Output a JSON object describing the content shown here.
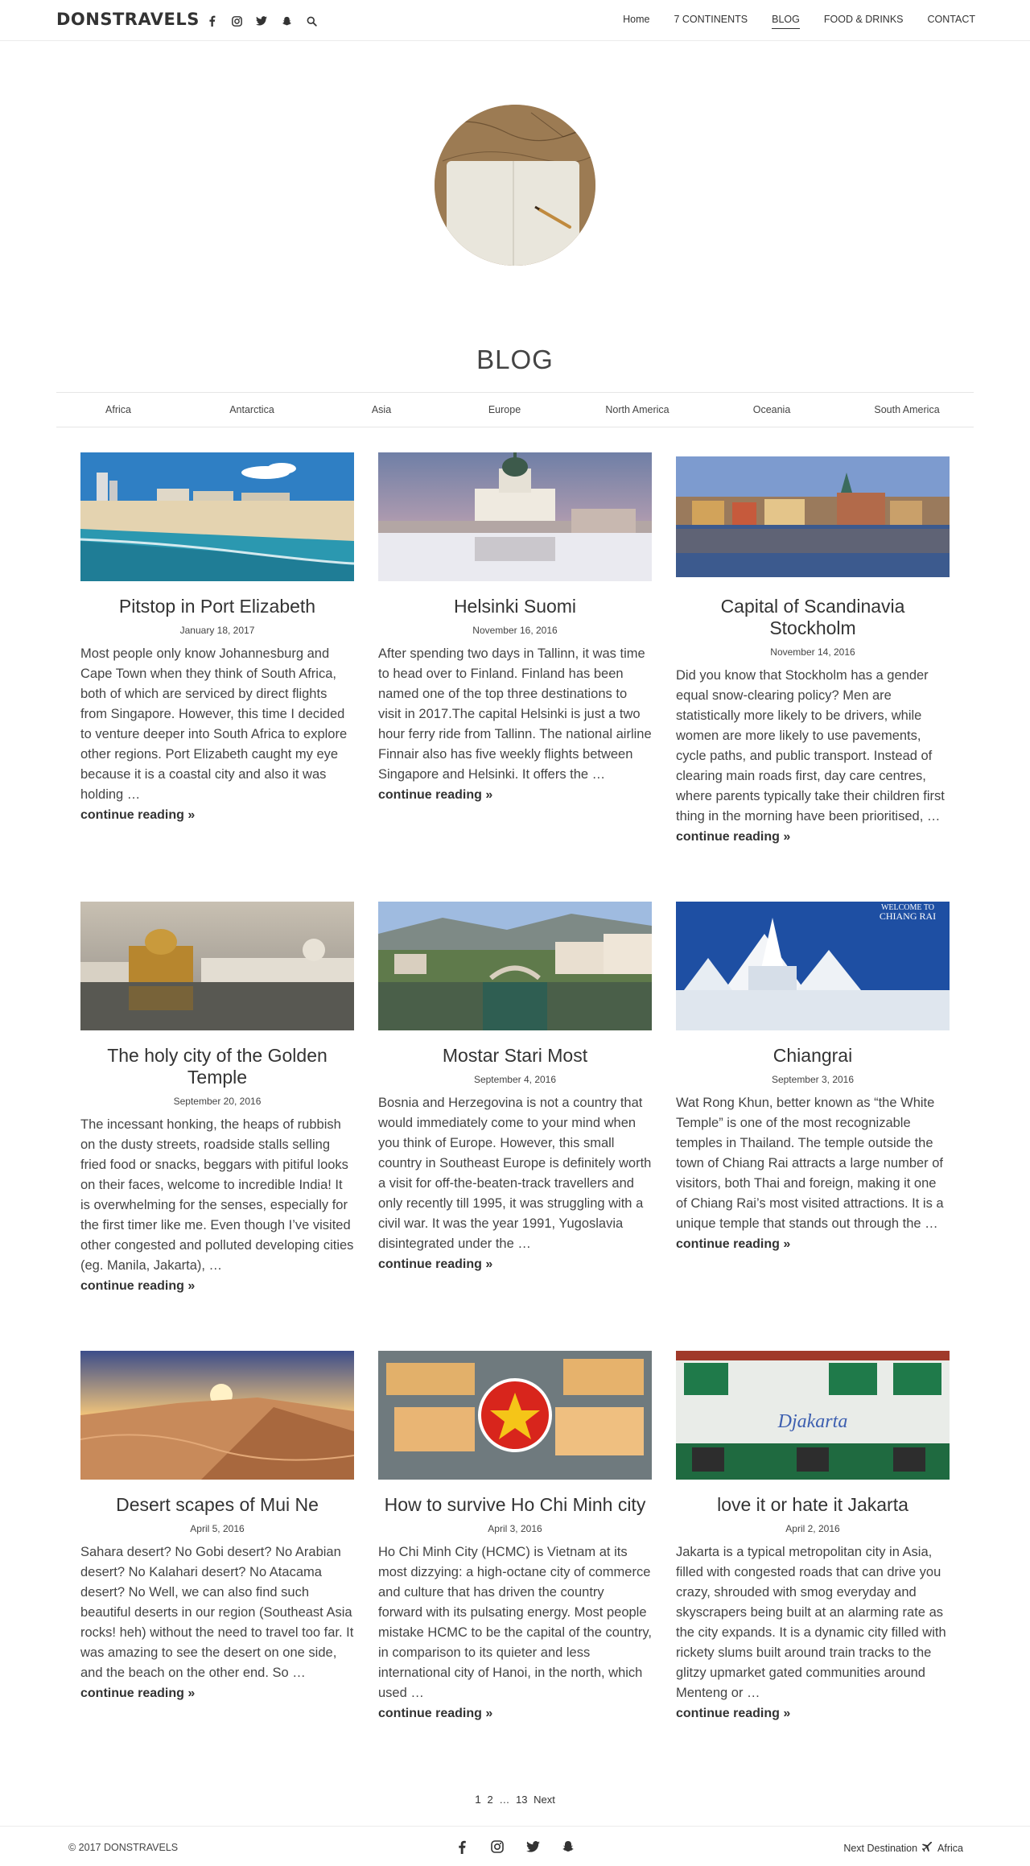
{
  "header": {
    "logo": "DONSTRAVELS",
    "nav": [
      "Home",
      "7 CONTINENTS",
      "BLOG",
      "FOOD & DRINKS",
      "CONTACT"
    ]
  },
  "page_title": "BLOG",
  "categories": [
    "Africa",
    "Antarctica",
    "Asia",
    "Europe",
    "North America",
    "Oceania",
    "South America"
  ],
  "posts": [
    {
      "title": "Pitstop in Port Elizabeth",
      "date": "January 18, 2017",
      "excerpt": "Most people only know Johannesburg and Cape Town when they think of South Africa, both of which are serviced by direct flights from Singapore. However, this time I decided to venture deeper into South Africa to explore other regions. Port Elizabeth caught my eye because it is a coastal city and also it was holding …",
      "more": "continue reading »"
    },
    {
      "title": "Helsinki Suomi",
      "date": "November 16, 2016",
      "excerpt": "After spending two days in Tallinn, it was time to head over to Finland. Finland has been named one of the top three destinations to visit in 2017.The capital Helsinki is just a two hour ferry ride from Tallinn. The national airline Finnair also has five weekly flights between Singapore and Helsinki. It offers the …",
      "more": "continue reading »"
    },
    {
      "title": "Capital of Scandinavia Stockholm",
      "date": "November 14, 2016",
      "excerpt": "Did you know that Stockholm has a gender equal snow-clearing policy? Men are statistically more likely to be drivers, while women are more likely to use pavements, cycle paths, and public transport. Instead of clearing main roads first, day care centres, where parents typically take their children first thing in the morning have been prioritised, …",
      "more": "continue reading »"
    },
    {
      "title": "The holy city of the Golden Temple",
      "date": "September 20, 2016",
      "excerpt": "The incessant honking, the heaps of rubbish on the dusty streets, roadside stalls selling fried food or snacks, beggars with pitiful looks on their faces, welcome to incredible India! It is overwhelming for the senses, especially for the first timer like me. Even though I’ve visited other congested and polluted developing cities (eg. Manila, Jakarta), …",
      "more": "continue reading »"
    },
    {
      "title": "Mostar Stari Most",
      "date": "September 4, 2016",
      "excerpt": "Bosnia and Herzegovina is not a country that would immediately come to your mind when you think of Europe. However, this small country in Southeast Europe is definitely worth a visit for off-the-beaten-track travellers and only recently till 1995, it was struggling with a civil war. It was the year 1991, Yugoslavia disintegrated under the …",
      "more": "continue reading »"
    },
    {
      "title": "Chiangrai",
      "date": "September 3, 2016",
      "excerpt": "Wat Rong Khun, better known as “the White Temple” is one of the most recognizable temples in Thailand. The temple outside the town of Chiang Rai attracts a large number of visitors, both Thai and foreign, making it one of Chiang Rai’s most visited attractions. It is a unique temple that stands out through the …",
      "more": "continue reading »",
      "image_caption_1": "WELCOME TO",
      "image_caption_2": "CHIANG RAI"
    },
    {
      "title": "Desert scapes of Mui Ne",
      "date": "April 5, 2016",
      "excerpt": "Sahara desert? No Gobi desert? No Arabian desert? No Kalahari desert? No Atacama desert? No Well, we can also find such beautiful deserts in our region (Southeast Asia rocks! heh) without the need to travel too far. It was amazing to see the desert on one side, and the beach on the other end. So …",
      "more": "continue reading »"
    },
    {
      "title": "How to survive Ho Chi Minh city",
      "date": "April 3, 2016",
      "excerpt": "Ho Chi Minh City (HCMC) is Vietnam at its most dizzying: a high-octane city of commerce and culture that has driven the country forward with its pulsating energy. Most people mistake HCMC to be the capital of the country, in comparison to its quieter and less international city of Hanoi, in the north, which used …",
      "more": "continue reading »"
    },
    {
      "title": "love it or hate it Jakarta",
      "date": "April 2, 2016",
      "excerpt": "Jakarta is a typical metropolitan city in Asia, filled with congested roads that can drive you crazy, shrouded with smog everyday and skyscrapers being built at an alarming rate as the city expands. It is a dynamic city filled with rickety slums built around train tracks to the glitzy upmarket gated communities around Menteng or …",
      "more": "continue reading »",
      "image_sign": "Djakarta"
    }
  ],
  "pagination": {
    "current": "1",
    "p2": "2",
    "ellipsis": "…",
    "last": "13",
    "next": "Next"
  },
  "footer": {
    "copyright": "© 2017 DONSTRAVELS",
    "next_label": "Next Destination",
    "next_dest": "Africa"
  },
  "colors": {
    "text": "#333333",
    "rule": "#e6e6e6"
  },
  "icons": [
    "facebook-icon",
    "instagram-icon",
    "twitter-icon",
    "snapchat-icon",
    "search-icon",
    "airplane-icon"
  ]
}
